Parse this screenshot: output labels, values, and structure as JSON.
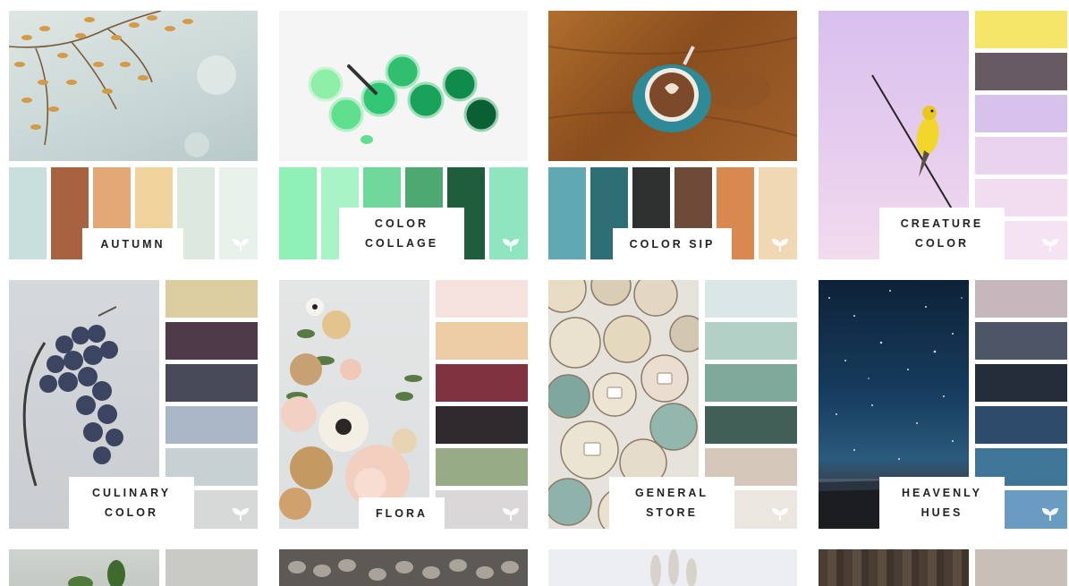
{
  "cards": [
    {
      "id": "autumn",
      "lines": [
        "AUTUMN"
      ],
      "icon": "leaf-sprout-icon",
      "swatches": [
        "#c9dfdd",
        "#a8623f",
        "#e3a876",
        "#f0d39b",
        "#dde9df",
        "#e8f1ea"
      ],
      "layout": "bottom"
    },
    {
      "id": "color-collage",
      "lines": [
        "COLOR",
        "COLLAGE"
      ],
      "icon": "leaf-sprout-icon",
      "swatches": [
        "#8ff0b5",
        "#a9f4c6",
        "#6fd99c",
        "#4ea872",
        "#1f5e3d",
        "#8fe5c0"
      ],
      "layout": "bottom"
    },
    {
      "id": "color-sip",
      "lines": [
        "COLOR SIP"
      ],
      "icon": "leaf-sprout-icon",
      "swatches": [
        "#5fa8b4",
        "#2d6f74",
        "#2f3030",
        "#6e4a38",
        "#d98950",
        "#f0d8b4"
      ],
      "layout": "bottom"
    },
    {
      "id": "creature-color",
      "lines": [
        "CREATURE",
        "COLOR"
      ],
      "icon": "leaf-sprout-icon",
      "swatches": [
        "#f5e66a",
        "#675a62",
        "#d7c2ec",
        "#ead3ef",
        "#f1dcf0",
        "#f5e3f3"
      ],
      "layout": "side"
    },
    {
      "id": "culinary-color",
      "lines": [
        "CULINARY",
        "COLOR"
      ],
      "icon": "leaf-sprout-icon",
      "swatches": [
        "#dccda0",
        "#4e3a48",
        "#494a58",
        "#a9b7c7",
        "#c7d0d3",
        "#d6d9d7"
      ],
      "layout": "side"
    },
    {
      "id": "flora",
      "lines": [
        "FLORA"
      ],
      "icon": "leaf-sprout-icon",
      "swatches": [
        "#f5e1dd",
        "#edcda6",
        "#7f3341",
        "#2e2a2d",
        "#97ab86",
        "#d9d7d8"
      ],
      "layout": "side"
    },
    {
      "id": "general-store",
      "lines": [
        "GENERAL",
        "STORE"
      ],
      "icon": "leaf-sprout-icon",
      "swatches": [
        "#dbe6e6",
        "#b3d0c7",
        "#7fa99a",
        "#415f57",
        "#d6c7bb",
        "#ebe6e0"
      ],
      "layout": "side"
    },
    {
      "id": "heavenly-hues",
      "lines": [
        "HEAVENLY",
        "HUES"
      ],
      "icon": "leaf-sprout-icon",
      "swatches": [
        "#c6b7bd",
        "#4e5566",
        "#252c3a",
        "#2d4c6b",
        "#3f7597",
        "#6a9cc2"
      ],
      "layout": "side"
    }
  ]
}
